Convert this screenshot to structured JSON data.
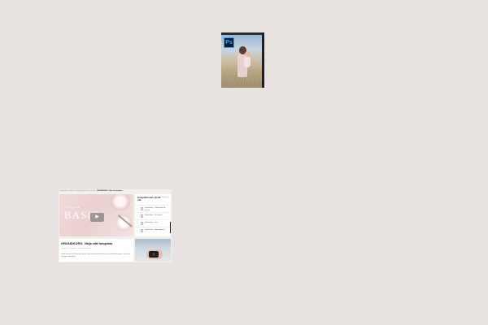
{
  "photoshop": {
    "logo_text": "Ps",
    "accent": "#31a8ff",
    "icon": "photoshop-logo-icon"
  },
  "course_page": {
    "breadcrumb": {
      "path": "Fotografikurs online › Fotografera barn på rätt sätt › ",
      "current": "GRUNDKURS: Välja rätt fotoplats"
    },
    "video": {
      "overlay_small": "ONLINE",
      "overlay_word": "BASIC",
      "play_icon": "play-icon",
      "play_glyph": "▶"
    },
    "lesson": {
      "title": "GRUNDKURS: Välja rätt fotoplats",
      "subtitle": "Lektion 2 · Grundkurs · Välja rätt fotoplats",
      "body": "I detta avsnitt får du lära dig hur du hittar den perfekta platsen för din fotografering och hur ljuset påverkar dina bilder."
    },
    "sidebar": {
      "heading": "Fotografera barn på rätt sätt",
      "count": "8 lektioner",
      "items": [
        {
          "num": "1",
          "label": "Introduktion · Välkommen till kursen"
        },
        {
          "num": "2",
          "label": "Introduktion · Utrustning"
        },
        {
          "num": "3",
          "label": "Introduktion · Ljus"
        },
        {
          "num": "4",
          "label": "Introduktion · Bildredigering"
        }
      ]
    }
  }
}
